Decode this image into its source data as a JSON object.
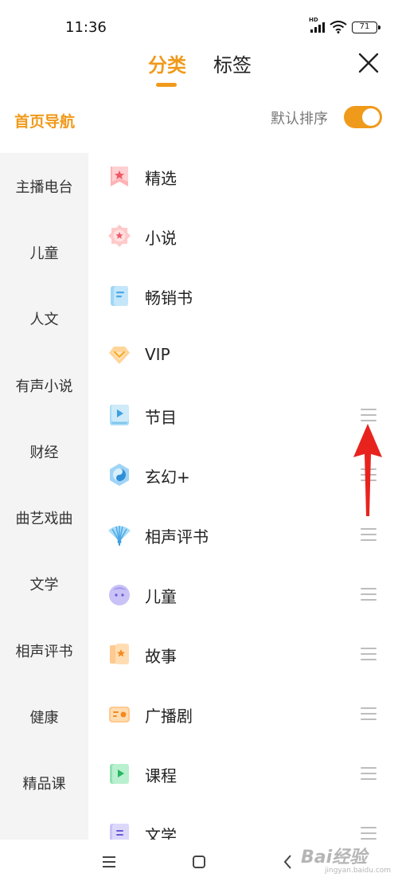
{
  "status_bar": {
    "time": "11:36",
    "battery": "71",
    "signal_label": "HD"
  },
  "header": {
    "tabs": [
      {
        "label": "分类",
        "active": true
      },
      {
        "label": "标签",
        "active": false
      }
    ],
    "close_icon": "close-icon"
  },
  "sort": {
    "home_nav": "首页导航",
    "default_sort_label": "默认排序",
    "toggle_on": true
  },
  "sidebar": {
    "items": [
      {
        "label": "主播电台"
      },
      {
        "label": "儿童"
      },
      {
        "label": "人文"
      },
      {
        "label": "有声小说"
      },
      {
        "label": "财经"
      },
      {
        "label": "曲艺戏曲"
      },
      {
        "label": "文学"
      },
      {
        "label": "相声评书"
      },
      {
        "label": "健康"
      },
      {
        "label": "精品课"
      }
    ]
  },
  "list": {
    "items": [
      {
        "label": "精选",
        "icon": "bookmark-star-icon",
        "draggable": false
      },
      {
        "label": "小说",
        "icon": "badge-star-icon",
        "draggable": false
      },
      {
        "label": "畅销书",
        "icon": "book-icon",
        "draggable": false
      },
      {
        "label": "VIP",
        "icon": "vip-diamond-icon",
        "draggable": false
      },
      {
        "label": "节目",
        "icon": "play-tablet-icon",
        "draggable": true
      },
      {
        "label": "玄幻+",
        "icon": "yin-yang-icon",
        "draggable": true
      },
      {
        "label": "相声评书",
        "icon": "fan-icon",
        "draggable": true
      },
      {
        "label": "儿童",
        "icon": "child-face-icon",
        "draggable": true
      },
      {
        "label": "故事",
        "icon": "story-book-icon",
        "draggable": true
      },
      {
        "label": "广播剧",
        "icon": "radio-icon",
        "draggable": true
      },
      {
        "label": "课程",
        "icon": "course-play-icon",
        "draggable": true
      },
      {
        "label": "文学",
        "icon": "literature-book-icon",
        "draggable": true
      }
    ]
  },
  "bottom_nav": {
    "items": [
      "menu-icon",
      "home-square-icon",
      "back-icon"
    ]
  },
  "watermark": {
    "text": "Bai经验",
    "sub": "jingyan.baidu.com"
  },
  "colors": {
    "accent": "#f09a1b",
    "arrow": "#e8231e"
  }
}
